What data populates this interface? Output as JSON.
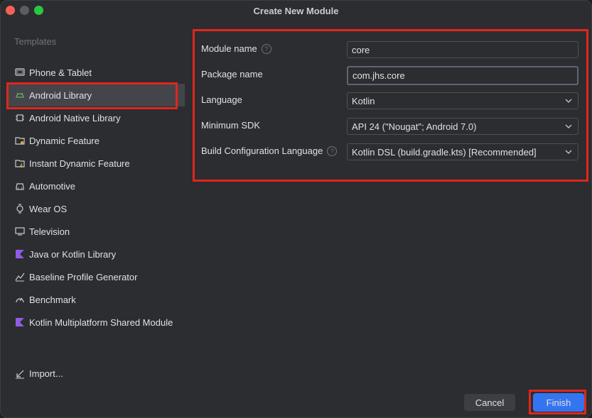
{
  "window": {
    "title": "Create New Module"
  },
  "sidebar": {
    "heading": "Templates",
    "items": [
      {
        "label": "Phone & Tablet",
        "icon": "phone-tablet-icon"
      },
      {
        "label": "Android Library",
        "icon": "android-icon"
      },
      {
        "label": "Android Native Library",
        "icon": "native-library-icon"
      },
      {
        "label": "Dynamic Feature",
        "icon": "dynamic-feature-icon"
      },
      {
        "label": "Instant Dynamic Feature",
        "icon": "instant-feature-icon"
      },
      {
        "label": "Automotive",
        "icon": "car-icon"
      },
      {
        "label": "Wear OS",
        "icon": "watch-icon"
      },
      {
        "label": "Television",
        "icon": "tv-icon"
      },
      {
        "label": "Java or Kotlin Library",
        "icon": "kotlin-icon"
      },
      {
        "label": "Baseline Profile Generator",
        "icon": "profile-icon"
      },
      {
        "label": "Benchmark",
        "icon": "gauge-icon"
      },
      {
        "label": "Kotlin Multiplatform Shared Module",
        "icon": "kotlin-icon"
      }
    ],
    "import_label": "Import..."
  },
  "form": {
    "module_name": {
      "label": "Module name",
      "value": "core"
    },
    "package_name": {
      "label": "Package name",
      "value": "com.jhs.core"
    },
    "language": {
      "label": "Language",
      "value": "Kotlin"
    },
    "min_sdk": {
      "label": "Minimum SDK",
      "value": "API 24 (\"Nougat\"; Android 7.0)"
    },
    "build_lang": {
      "label": "Build Configuration Language",
      "value": "Kotlin DSL (build.gradle.kts) [Recommended]"
    }
  },
  "buttons": {
    "cancel": "Cancel",
    "finish": "Finish"
  },
  "colors": {
    "accent": "#3574f0",
    "highlight": "#e1261c",
    "selected_bg": "#43454a"
  }
}
